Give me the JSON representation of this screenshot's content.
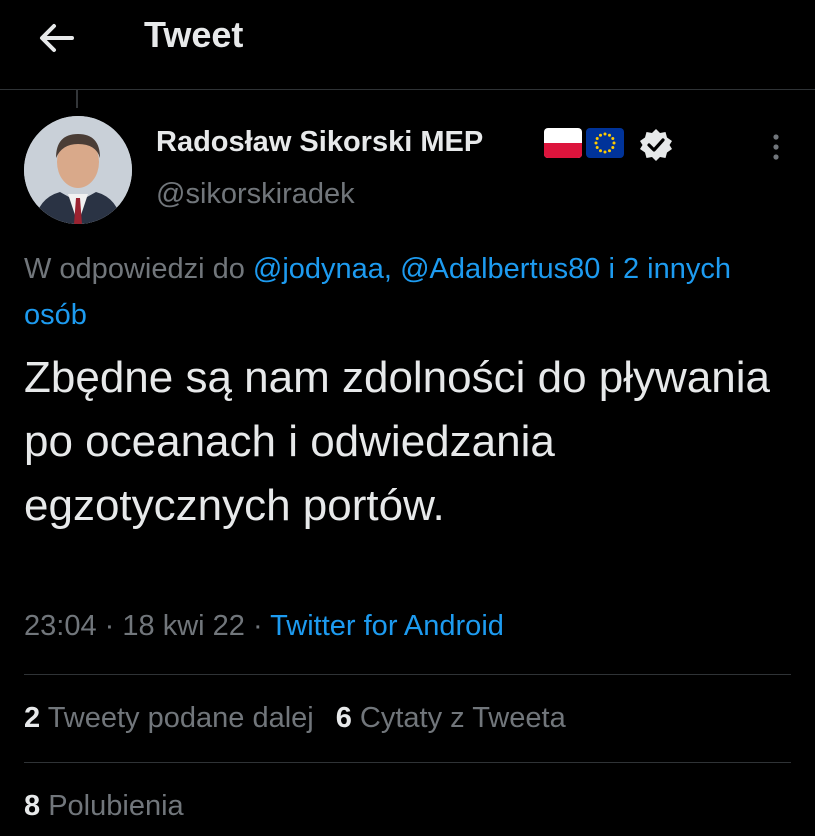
{
  "header": {
    "title": "Tweet"
  },
  "author": {
    "display_name": "Radosław Sikorski MEP",
    "handle": "@sikorskiradek",
    "flag_icons": [
      "flag-poland-icon",
      "flag-eu-icon"
    ],
    "verified_icon": "verified-badge-icon"
  },
  "reply": {
    "prefix": "W odpowiedzi do",
    "user1": "@jodynaa,",
    "user2": "@Adalbertus80",
    "others": "i 2 innych osób"
  },
  "tweet": {
    "text": "Zbędne są nam zdolności do pływania po oceanach i odwiedzania egzotycznych portów.",
    "time": "23:04",
    "sep1": "·",
    "date": "18 kwi 22",
    "sep2": "·",
    "source": "Twitter for Android"
  },
  "stats": {
    "retweets_count": "2",
    "retweets_label": "Tweety podane dalej",
    "quotes_count": "6",
    "quotes_label": "Cytaty z Tweeta",
    "likes_count": "8",
    "likes_label": "Polubienia"
  },
  "colors": {
    "background": "#000000",
    "text": "#e7e9ea",
    "secondary": "#71767b",
    "link": "#1d9bf0",
    "divider": "#2f3336"
  }
}
